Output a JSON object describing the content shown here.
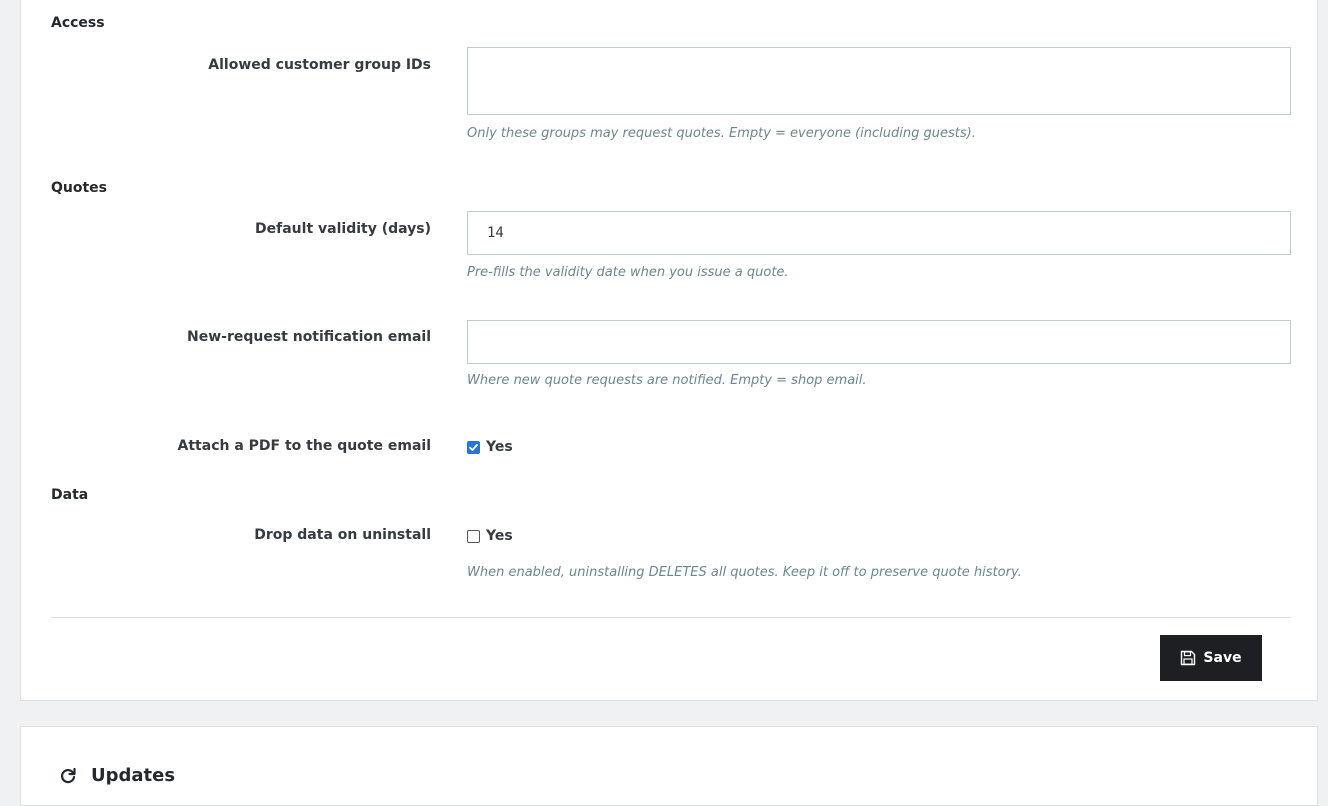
{
  "sections": {
    "access": "Access",
    "quotes": "Quotes",
    "data": "Data"
  },
  "fields": {
    "allowed_groups": {
      "label": "Allowed customer group IDs",
      "value": "",
      "help": "Only these groups may request quotes. Empty = everyone (including guests)."
    },
    "default_validity": {
      "label": "Default validity (days)",
      "value": "14",
      "help": "Pre-fills the validity date when you issue a quote."
    },
    "notification_email": {
      "label": "New-request notification email",
      "value": "",
      "help": "Where new quote requests are notified. Empty = shop email."
    },
    "attach_pdf": {
      "label": "Attach a PDF to the quote email",
      "option": "Yes",
      "checked": true
    },
    "drop_data": {
      "label": "Drop data on uninstall",
      "option": "Yes",
      "checked": false,
      "help": "When enabled, uninstalling DELETES all quotes. Keep it off to preserve quote history."
    }
  },
  "actions": {
    "save_label": "Save"
  },
  "updates_panel": {
    "title": "Updates"
  },
  "icons": {
    "save": "floppy-disk-icon",
    "updates": "refresh-icon"
  },
  "colors": {
    "checkbox_accent": "#2a74d4",
    "save_button_bg": "#1d1f22"
  }
}
